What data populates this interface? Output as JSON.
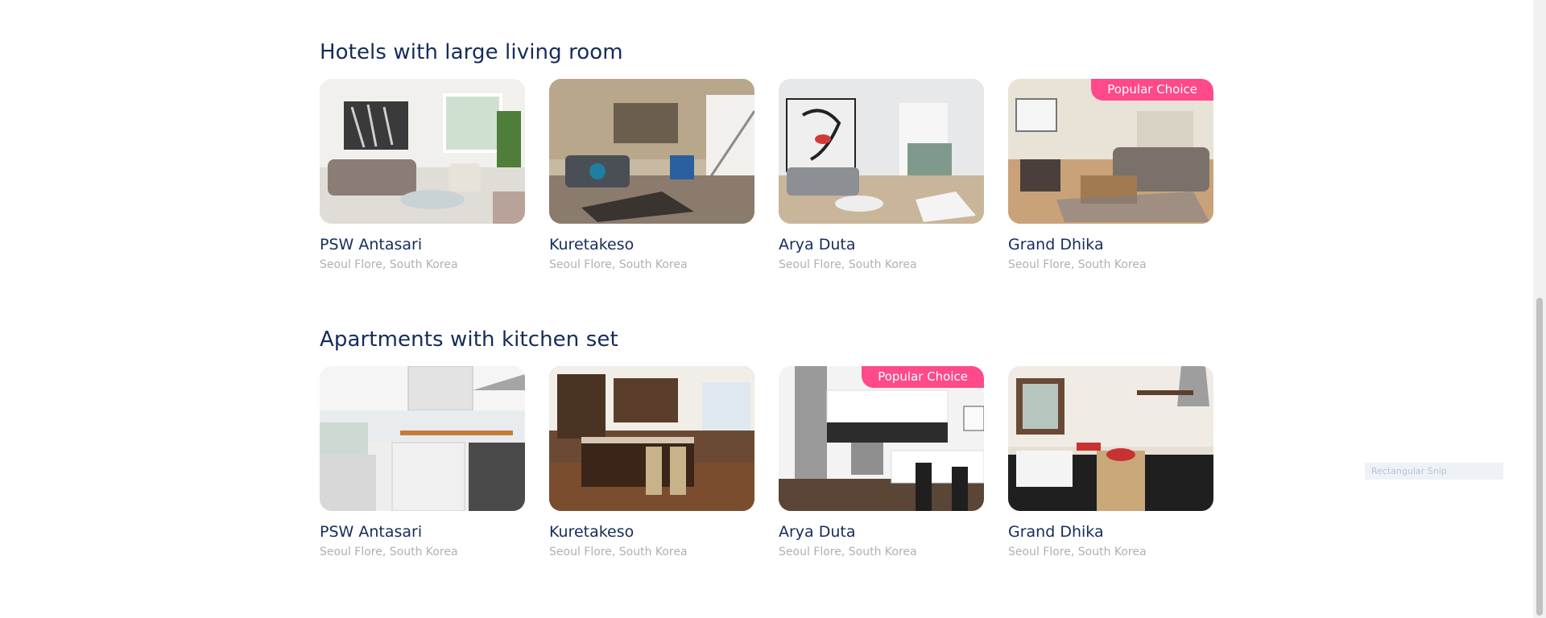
{
  "sections": [
    {
      "title": "Hotels with large living room",
      "cards": [
        {
          "name": "PSW Antasari",
          "location": "Seoul Flore, South Korea",
          "badge": ""
        },
        {
          "name": "Kuretakeso",
          "location": "Seoul Flore, South Korea",
          "badge": ""
        },
        {
          "name": "Arya Duta",
          "location": "Seoul Flore, South Korea",
          "badge": ""
        },
        {
          "name": "Grand Dhika",
          "location": "Seoul Flore, South Korea",
          "badge": "Popular Choice"
        }
      ]
    },
    {
      "title": "Apartments with kitchen set",
      "cards": [
        {
          "name": "PSW Antasari",
          "location": "Seoul Flore, South Korea",
          "badge": ""
        },
        {
          "name": "Kuretakeso",
          "location": "Seoul Flore, South Korea",
          "badge": ""
        },
        {
          "name": "Arya Duta",
          "location": "Seoul Flore, South Korea",
          "badge": "Popular Choice"
        },
        {
          "name": "Grand Dhika",
          "location": "Seoul Flore, South Korea",
          "badge": ""
        }
      ]
    }
  ],
  "overlay": {
    "snip_label": "Rectangular Snip"
  },
  "colors": {
    "title": "#152c5b",
    "subtitle": "#b0b0b0",
    "badge": "#ff498b"
  }
}
